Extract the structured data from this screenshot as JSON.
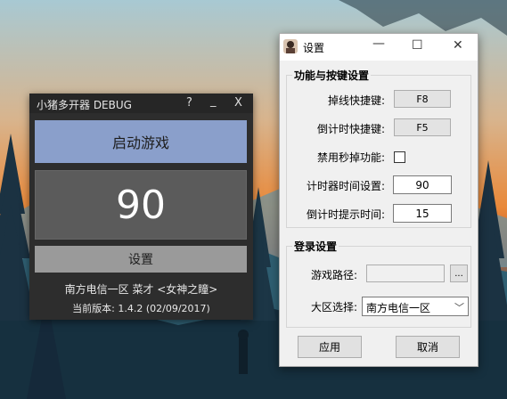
{
  "main_window": {
    "title": "小猪多开器 DEBUG",
    "help_label": "?",
    "minimize_label": "_",
    "close_label": "X",
    "start_game_label": "启动游戏",
    "counter_value": "90",
    "settings_label": "设置",
    "region_info": "南方电信一区 菜才 <女神之瞳>",
    "version_info": "当前版本: 1.4.2 (02/09/2017)"
  },
  "settings_window": {
    "title": "设置",
    "hotkeys_group": {
      "title": "功能与按键设置",
      "disconnect_hotkey_label": "掉线快捷键:",
      "disconnect_hotkey_value": "F8",
      "countdown_hotkey_label": "倒计时快捷键:",
      "countdown_hotkey_value": "F5",
      "disable_instant_drop_label": "禁用秒掉功能:",
      "disable_instant_drop_checked": false,
      "timer_time_label": "计时器时间设置:",
      "timer_time_value": "90",
      "countdown_hint_label": "倒计时提示时间:",
      "countdown_hint_value": "15"
    },
    "login_group": {
      "title": "登录设置",
      "game_path_label": "游戏路径:",
      "game_path_value": "",
      "browse_label": "...",
      "region_label": "大区选择:",
      "region_value": "南方电信一区"
    },
    "apply_label": "应用",
    "cancel_label": "取消"
  },
  "colors": {
    "start_button": "#8a9fcb",
    "counter_bg": "#5b5b5b",
    "main_bg": "#2d2d2d"
  }
}
